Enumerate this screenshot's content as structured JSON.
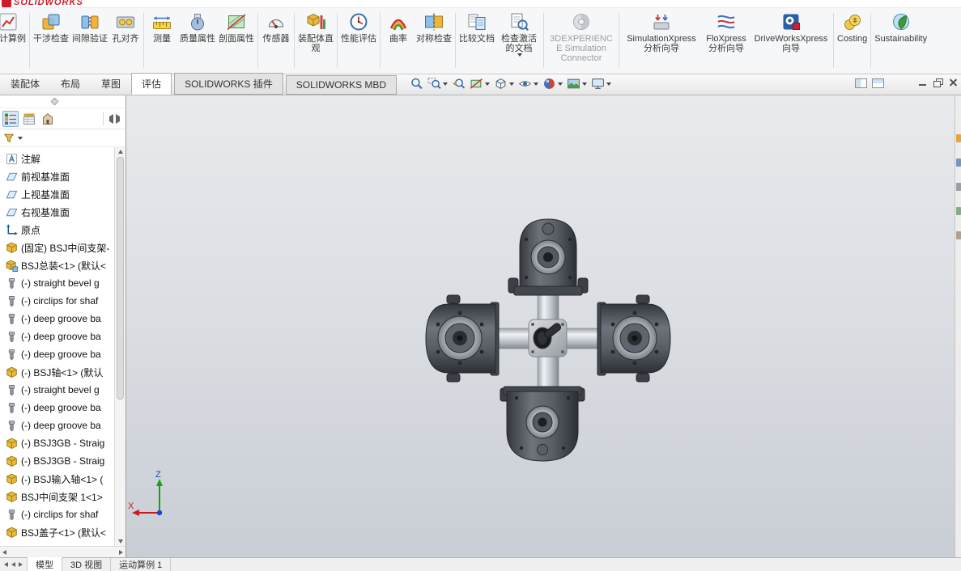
{
  "titlebar": {
    "brand": "SOLIDWORKS"
  },
  "ribbon": {
    "partial_tool": {
      "label": "设计算例",
      "icon": "design-study-icon"
    },
    "tools": [
      {
        "label": "干涉检查",
        "icon": "interference-check-icon"
      },
      {
        "label": "间隙验证",
        "icon": "clearance-verification-icon"
      },
      {
        "label": "孔对齐",
        "icon": "hole-alignment-icon"
      },
      {
        "label": "测量",
        "icon": "measure-icon"
      },
      {
        "label": "质量属性",
        "icon": "mass-properties-icon"
      },
      {
        "label": "剖面属性",
        "icon": "section-properties-icon"
      },
      {
        "label": "传感器",
        "icon": "sensors-icon"
      },
      {
        "label": "装配体直观",
        "icon": "assembly-visualization-icon"
      },
      {
        "label": "性能评估",
        "icon": "performance-evaluation-icon"
      },
      {
        "label": "曲率",
        "icon": "curvature-icon"
      },
      {
        "label": "对称检查",
        "icon": "symmetry-check-icon"
      },
      {
        "label": "比较文档",
        "icon": "compare-documents-icon"
      },
      {
        "label": "检查激活的文档",
        "icon": "check-active-document-icon",
        "dropdown": true
      },
      {
        "label": "3DEXPERIENCE Simulation Connector",
        "icon": "3dexperience-connector-icon",
        "disabled": true
      },
      {
        "label": "SimulationXpress 分析向导",
        "icon": "simulationxpress-icon"
      },
      {
        "label": "FloXpress 分析向导",
        "icon": "floxpress-icon"
      },
      {
        "label": "DriveWorksXpress 向导",
        "icon": "driveworksxpress-icon"
      },
      {
        "label": "Costing",
        "icon": "costing-icon"
      },
      {
        "label": "Sustainability",
        "icon": "sustainability-icon"
      }
    ]
  },
  "command_tabs": [
    {
      "label": "装配体",
      "active": false
    },
    {
      "label": "布局",
      "active": false
    },
    {
      "label": "草图",
      "active": false
    },
    {
      "label": "评估",
      "active": true
    },
    {
      "label": "SOLIDWORKS 插件",
      "active": false
    },
    {
      "label": "SOLIDWORKS MBD",
      "active": false
    }
  ],
  "headsup_icons": [
    "zoom-fit-icon",
    "zoom-area-icon",
    "previous-view-icon",
    "section-view-icon",
    "display-style-icon",
    "hide-show-items-icon",
    "edit-appearance-icon",
    "apply-scene-icon",
    "view-orientation-icon"
  ],
  "window_controls": [
    "tile-window-icon",
    "cascade-window-icon",
    "minimize-button",
    "restore-button",
    "close-button"
  ],
  "feature_tree": {
    "panel_tabs": [
      "featuremanager-tab",
      "propertymanager-tab",
      "configurationmanager-tab"
    ],
    "filter_icon": "filter-icon",
    "items": [
      {
        "label": "注解",
        "icon": "annotations-icon"
      },
      {
        "label": "前视基准面",
        "icon": "plane-icon"
      },
      {
        "label": "上视基准面",
        "icon": "plane-icon"
      },
      {
        "label": "右视基准面",
        "icon": "plane-icon"
      },
      {
        "label": "原点",
        "icon": "origin-icon"
      },
      {
        "label": "(固定) BSJ中间支架-",
        "icon": "part-icon"
      },
      {
        "label": "BSJ总装<1> (默认<",
        "icon": "assembly-icon"
      },
      {
        "label": "(-) straight bevel g",
        "icon": "fastener-icon"
      },
      {
        "label": "(-) circlips for shaf",
        "icon": "fastener-icon"
      },
      {
        "label": "(-) deep groove ba",
        "icon": "fastener-icon"
      },
      {
        "label": "(-) deep groove ba",
        "icon": "fastener-icon"
      },
      {
        "label": "(-) deep groove ba",
        "icon": "fastener-icon"
      },
      {
        "label": "(-) BSJ轴<1> (默认",
        "icon": "part-icon"
      },
      {
        "label": "(-) straight bevel g",
        "icon": "fastener-icon"
      },
      {
        "label": "(-) deep groove ba",
        "icon": "fastener-icon"
      },
      {
        "label": "(-) deep groove ba",
        "icon": "fastener-icon"
      },
      {
        "label": "(-) BSJ3GB - Straig",
        "icon": "part-icon"
      },
      {
        "label": "(-) BSJ3GB - Straig",
        "icon": "part-icon"
      },
      {
        "label": "(-) BSJ输入轴<1> (",
        "icon": "part-icon"
      },
      {
        "label": "BSJ中间支架 1<1>",
        "icon": "part-icon"
      },
      {
        "label": "(-) circlips for shaf",
        "icon": "fastener-icon"
      },
      {
        "label": "BSJ盖子<1> (默认<",
        "icon": "part-icon"
      }
    ]
  },
  "viewport": {
    "triad": {
      "z_label": "Z",
      "x_label": "X"
    }
  },
  "statusbar": {
    "tabs": [
      {
        "label": "模型",
        "active": true
      },
      {
        "label": "3D 视图",
        "active": false
      },
      {
        "label": "运动算例 1",
        "active": false
      }
    ]
  }
}
